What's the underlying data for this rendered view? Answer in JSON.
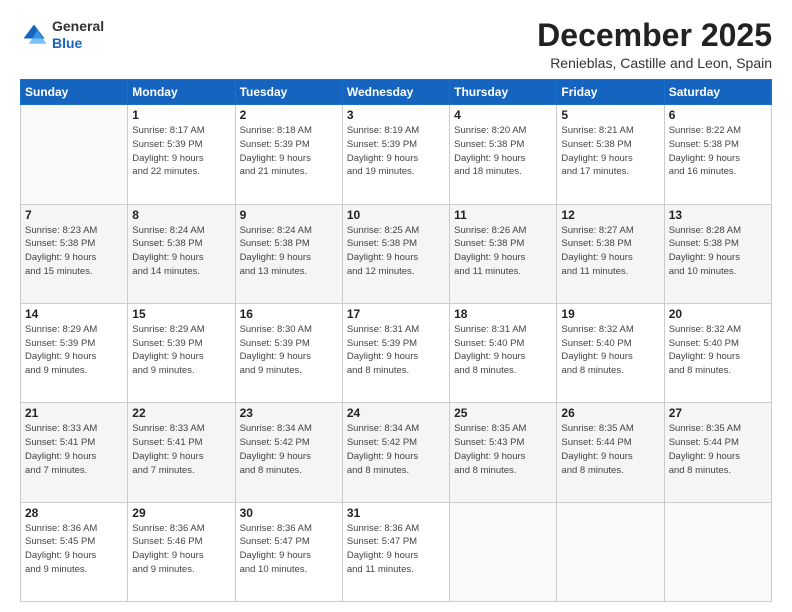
{
  "header": {
    "logo_line1": "General",
    "logo_line2": "Blue",
    "month": "December 2025",
    "location": "Renieblas, Castille and Leon, Spain"
  },
  "weekdays": [
    "Sunday",
    "Monday",
    "Tuesday",
    "Wednesday",
    "Thursday",
    "Friday",
    "Saturday"
  ],
  "weeks": [
    [
      {
        "day": "",
        "info": ""
      },
      {
        "day": "1",
        "info": "Sunrise: 8:17 AM\nSunset: 5:39 PM\nDaylight: 9 hours\nand 22 minutes."
      },
      {
        "day": "2",
        "info": "Sunrise: 8:18 AM\nSunset: 5:39 PM\nDaylight: 9 hours\nand 21 minutes."
      },
      {
        "day": "3",
        "info": "Sunrise: 8:19 AM\nSunset: 5:39 PM\nDaylight: 9 hours\nand 19 minutes."
      },
      {
        "day": "4",
        "info": "Sunrise: 8:20 AM\nSunset: 5:38 PM\nDaylight: 9 hours\nand 18 minutes."
      },
      {
        "day": "5",
        "info": "Sunrise: 8:21 AM\nSunset: 5:38 PM\nDaylight: 9 hours\nand 17 minutes."
      },
      {
        "day": "6",
        "info": "Sunrise: 8:22 AM\nSunset: 5:38 PM\nDaylight: 9 hours\nand 16 minutes."
      }
    ],
    [
      {
        "day": "7",
        "info": "Sunrise: 8:23 AM\nSunset: 5:38 PM\nDaylight: 9 hours\nand 15 minutes."
      },
      {
        "day": "8",
        "info": "Sunrise: 8:24 AM\nSunset: 5:38 PM\nDaylight: 9 hours\nand 14 minutes."
      },
      {
        "day": "9",
        "info": "Sunrise: 8:24 AM\nSunset: 5:38 PM\nDaylight: 9 hours\nand 13 minutes."
      },
      {
        "day": "10",
        "info": "Sunrise: 8:25 AM\nSunset: 5:38 PM\nDaylight: 9 hours\nand 12 minutes."
      },
      {
        "day": "11",
        "info": "Sunrise: 8:26 AM\nSunset: 5:38 PM\nDaylight: 9 hours\nand 11 minutes."
      },
      {
        "day": "12",
        "info": "Sunrise: 8:27 AM\nSunset: 5:38 PM\nDaylight: 9 hours\nand 11 minutes."
      },
      {
        "day": "13",
        "info": "Sunrise: 8:28 AM\nSunset: 5:38 PM\nDaylight: 9 hours\nand 10 minutes."
      }
    ],
    [
      {
        "day": "14",
        "info": "Sunrise: 8:29 AM\nSunset: 5:39 PM\nDaylight: 9 hours\nand 9 minutes."
      },
      {
        "day": "15",
        "info": "Sunrise: 8:29 AM\nSunset: 5:39 PM\nDaylight: 9 hours\nand 9 minutes."
      },
      {
        "day": "16",
        "info": "Sunrise: 8:30 AM\nSunset: 5:39 PM\nDaylight: 9 hours\nand 9 minutes."
      },
      {
        "day": "17",
        "info": "Sunrise: 8:31 AM\nSunset: 5:39 PM\nDaylight: 9 hours\nand 8 minutes."
      },
      {
        "day": "18",
        "info": "Sunrise: 8:31 AM\nSunset: 5:40 PM\nDaylight: 9 hours\nand 8 minutes."
      },
      {
        "day": "19",
        "info": "Sunrise: 8:32 AM\nSunset: 5:40 PM\nDaylight: 9 hours\nand 8 minutes."
      },
      {
        "day": "20",
        "info": "Sunrise: 8:32 AM\nSunset: 5:40 PM\nDaylight: 9 hours\nand 8 minutes."
      }
    ],
    [
      {
        "day": "21",
        "info": "Sunrise: 8:33 AM\nSunset: 5:41 PM\nDaylight: 9 hours\nand 7 minutes."
      },
      {
        "day": "22",
        "info": "Sunrise: 8:33 AM\nSunset: 5:41 PM\nDaylight: 9 hours\nand 7 minutes."
      },
      {
        "day": "23",
        "info": "Sunrise: 8:34 AM\nSunset: 5:42 PM\nDaylight: 9 hours\nand 8 minutes."
      },
      {
        "day": "24",
        "info": "Sunrise: 8:34 AM\nSunset: 5:42 PM\nDaylight: 9 hours\nand 8 minutes."
      },
      {
        "day": "25",
        "info": "Sunrise: 8:35 AM\nSunset: 5:43 PM\nDaylight: 9 hours\nand 8 minutes."
      },
      {
        "day": "26",
        "info": "Sunrise: 8:35 AM\nSunset: 5:44 PM\nDaylight: 9 hours\nand 8 minutes."
      },
      {
        "day": "27",
        "info": "Sunrise: 8:35 AM\nSunset: 5:44 PM\nDaylight: 9 hours\nand 8 minutes."
      }
    ],
    [
      {
        "day": "28",
        "info": "Sunrise: 8:36 AM\nSunset: 5:45 PM\nDaylight: 9 hours\nand 9 minutes."
      },
      {
        "day": "29",
        "info": "Sunrise: 8:36 AM\nSunset: 5:46 PM\nDaylight: 9 hours\nand 9 minutes."
      },
      {
        "day": "30",
        "info": "Sunrise: 8:36 AM\nSunset: 5:47 PM\nDaylight: 9 hours\nand 10 minutes."
      },
      {
        "day": "31",
        "info": "Sunrise: 8:36 AM\nSunset: 5:47 PM\nDaylight: 9 hours\nand 11 minutes."
      },
      {
        "day": "",
        "info": ""
      },
      {
        "day": "",
        "info": ""
      },
      {
        "day": "",
        "info": ""
      }
    ]
  ]
}
